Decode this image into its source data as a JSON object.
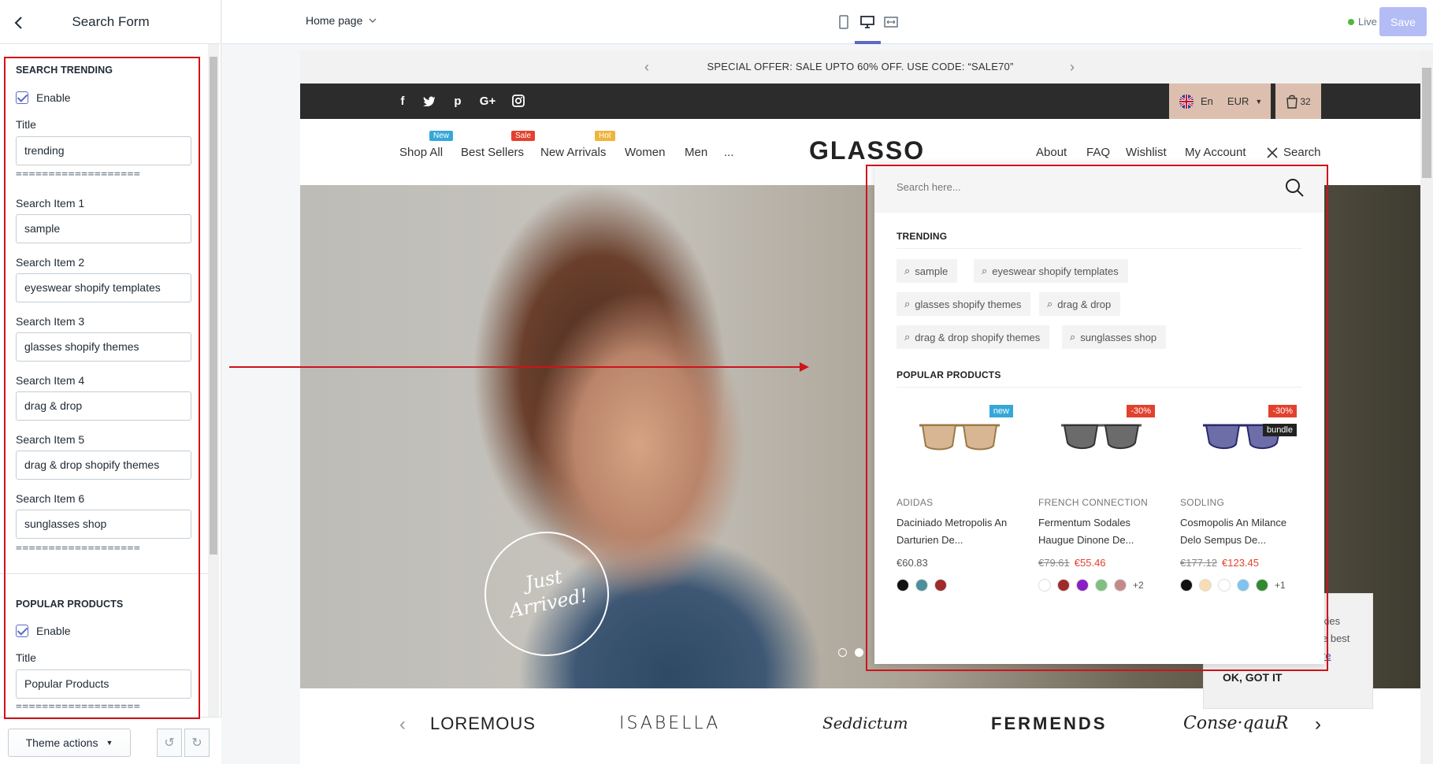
{
  "sidebar": {
    "title": "Search Form",
    "trending": {
      "heading": "SEARCH TRENDING",
      "enable_label": "Enable",
      "title_label": "Title",
      "title_value": "trending",
      "separator": "===================",
      "items": [
        {
          "label": "Search Item 1",
          "value": "sample"
        },
        {
          "label": "Search Item 2",
          "value": "eyeswear shopify templates"
        },
        {
          "label": "Search Item 3",
          "value": "glasses shopify themes"
        },
        {
          "label": "Search Item 4",
          "value": "drag & drop"
        },
        {
          "label": "Search Item 5",
          "value": "drag & drop shopify themes"
        },
        {
          "label": "Search Item 6",
          "value": "sunglasses shop"
        }
      ]
    },
    "popular": {
      "heading": "POPULAR PRODUCTS",
      "enable_label": "Enable",
      "title_label": "Title",
      "title_value": "Popular Products",
      "separator": "==================="
    },
    "footer": {
      "theme_actions": "Theme actions"
    }
  },
  "topbar": {
    "page_select": "Home page",
    "live_label": "Live",
    "save_label": "Save"
  },
  "store": {
    "announcement": "SPECIAL OFFER: SALE UPTO 60% OFF. USE CODE: “SALE70”",
    "language": "En",
    "currency": "EUR",
    "cart_count": "32",
    "nav": [
      {
        "label": "Shop All",
        "badge": "New",
        "badge_color": "#35a8d8"
      },
      {
        "label": "Best Sellers",
        "badge": "Sale",
        "badge_color": "#e2412e"
      },
      {
        "label": "New Arrivals",
        "badge": "Hot",
        "badge_color": "#f0b43c"
      },
      {
        "label": "Women"
      },
      {
        "label": "Men"
      },
      {
        "label": "..."
      }
    ],
    "logo": "GLASSO",
    "right_nav": [
      "About",
      "FAQ",
      "Wishlist",
      "My Account",
      "Search"
    ],
    "hero_badge": "Just Arrived!",
    "brands": [
      "LOREMOUS",
      "ISABELLA",
      "Seddictum",
      "FERMENDS",
      "Conse·qauR"
    ],
    "search": {
      "placeholder": "Search here...",
      "trending_title": "TRENDING",
      "tags": [
        "sample",
        "eyeswear shopify templates",
        "glasses shopify themes",
        "drag & drop",
        "drag & drop shopify themes",
        "sunglasses shop"
      ],
      "popular_title": "POPULAR PRODUCTS",
      "products": [
        {
          "badge": "new",
          "badge_color": "#35a8d8",
          "brand": "ADIDAS",
          "name": "Daciniado Metropolis An Darturien De...",
          "old_price": "",
          "price": "€60.83",
          "swatches": [
            "#111111",
            "#4d8f9a",
            "#a02b2b"
          ],
          "more": ""
        },
        {
          "badge": "-30%",
          "badge_color": "#e2412e",
          "brand": "FRENCH CONNECTION",
          "name": "Fermentum Sodales Haugue Dinone De...",
          "old_price": "€79.61",
          "price": "€55.46",
          "swatches": [
            "#ffffff",
            "#a02b2b",
            "#8a1fc7",
            "#7fbf7f",
            "#c48a8a"
          ],
          "more": "+2"
        },
        {
          "badge": "-30%",
          "badge_color": "#e2412e",
          "extra_badge": "bundle",
          "brand": "SODLING",
          "name": "Cosmopolis An Milance Delo Sempus De...",
          "old_price": "€177.12",
          "price": "€123.45",
          "swatches": [
            "#111111",
            "#f7dcb4",
            "#ffffff",
            "#7fc3ef",
            "#2e8b2e"
          ],
          "more": "+1"
        }
      ]
    },
    "cookie": {
      "line1": "kies",
      "line2": "e best",
      "line3": "re",
      "button": "OK, GOT IT"
    }
  }
}
